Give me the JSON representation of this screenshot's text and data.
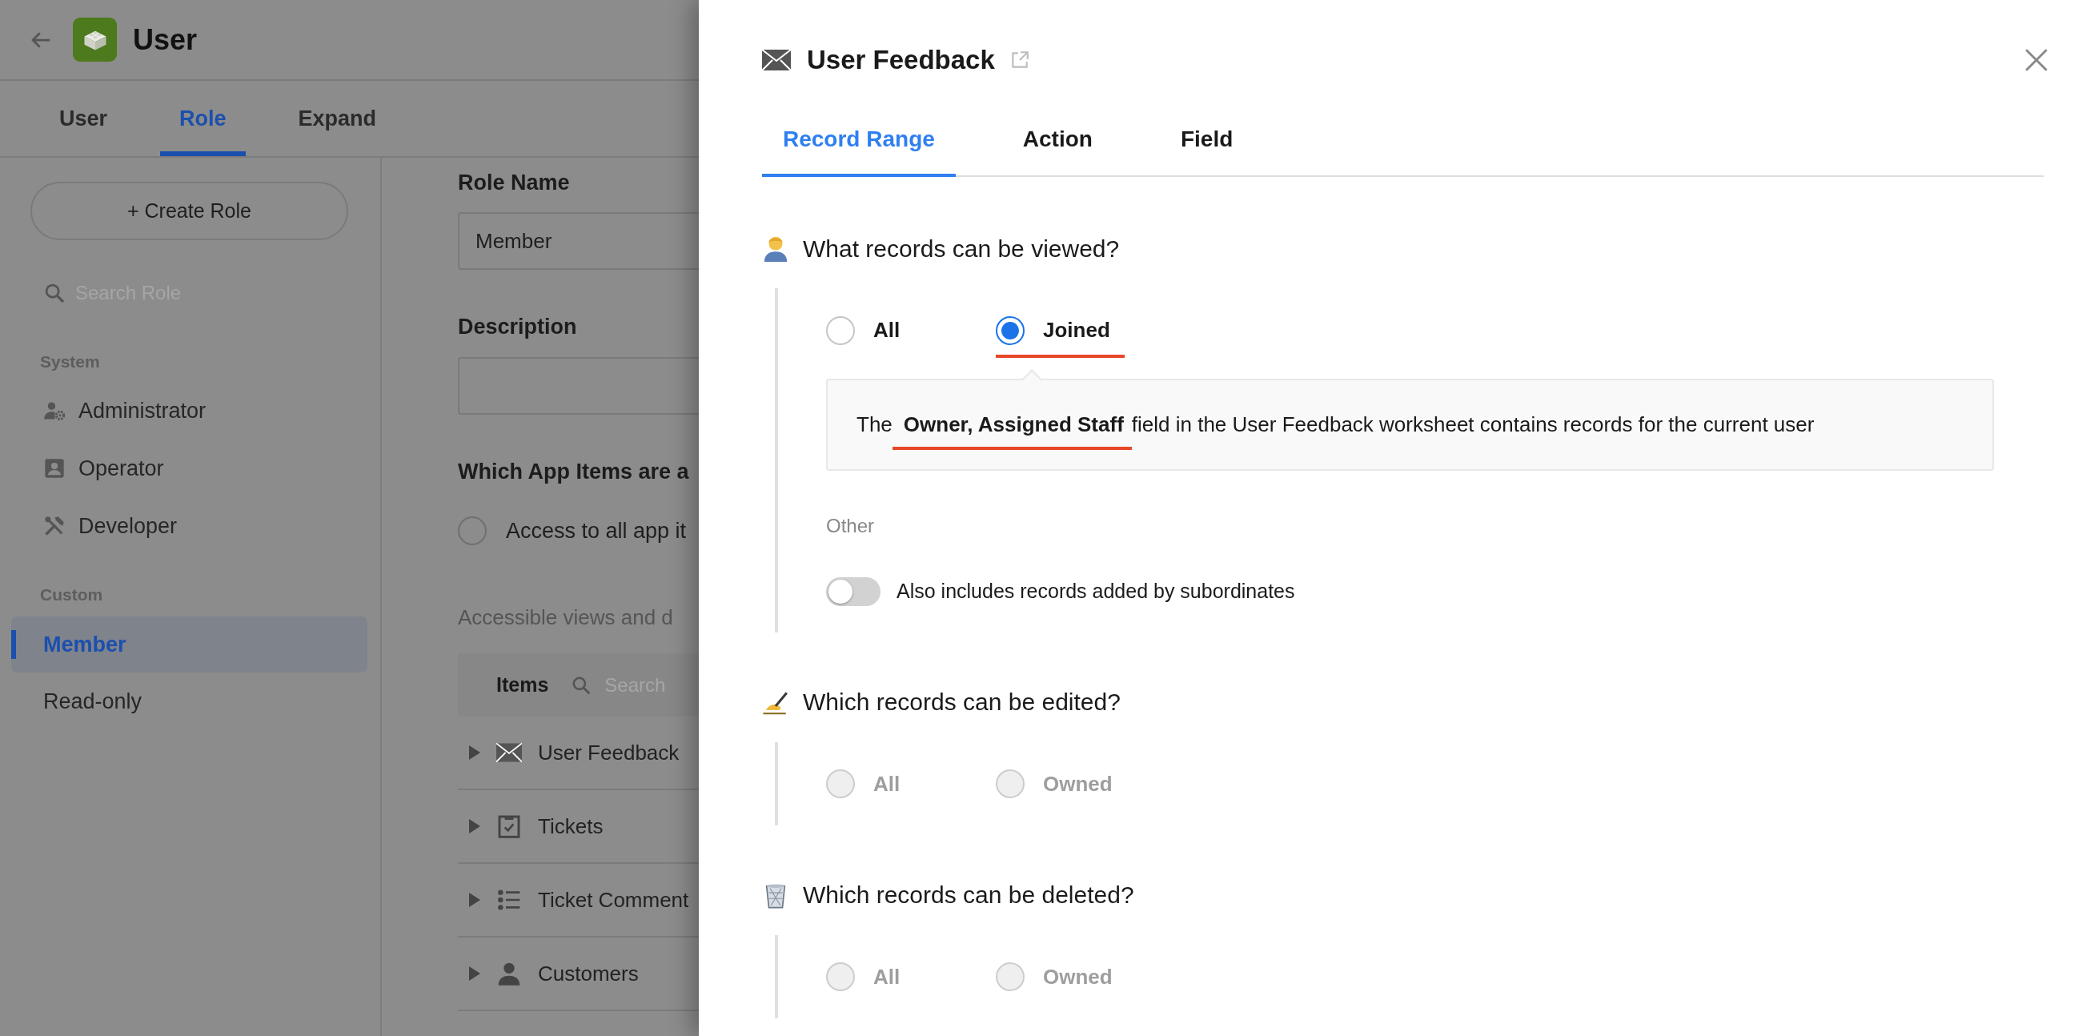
{
  "app_bar": {
    "title": "User"
  },
  "tabs": [
    {
      "label": "User",
      "selected": false
    },
    {
      "label": "Role",
      "selected": true
    },
    {
      "label": "Expand",
      "selected": false
    }
  ],
  "sidebar": {
    "create_button": "+ Create Role",
    "search_placeholder": "Search Role",
    "groups": [
      {
        "heading": "System",
        "items": [
          {
            "label": "Administrator",
            "selected": false
          },
          {
            "label": "Operator",
            "selected": false
          },
          {
            "label": "Developer",
            "selected": false
          }
        ]
      },
      {
        "heading": "Custom",
        "items": [
          {
            "label": "Member",
            "selected": true
          },
          {
            "label": "Read-only",
            "selected": false
          }
        ]
      }
    ]
  },
  "role_form": {
    "name_label": "Role Name",
    "name_value": "Member",
    "description_label": "Description",
    "items_heading": "Which App Items are a",
    "access_option": {
      "label": "Access to all app it",
      "selected": false
    },
    "accessible_note": "Accessible views and d",
    "items_table": {
      "header": "Items",
      "search_placeholder": "Search",
      "rows": [
        {
          "label": "User Feedback",
          "expanded": false
        },
        {
          "label": "Tickets",
          "expanded": false
        },
        {
          "label": "Ticket Comment",
          "expanded": false
        },
        {
          "label": "Customers",
          "expanded": false
        }
      ]
    }
  },
  "drawer": {
    "title": "User Feedback",
    "tabs": [
      {
        "label": "Record Range",
        "selected": true
      },
      {
        "label": "Action",
        "selected": false
      },
      {
        "label": "Field",
        "selected": false
      }
    ],
    "sections": [
      {
        "question": "What records can be viewed?",
        "options": [
          {
            "label": "All",
            "selected": false,
            "disabled": false,
            "annotated": false
          },
          {
            "label": "Joined",
            "selected": true,
            "disabled": false,
            "annotated": true
          }
        ],
        "info": {
          "prefix": "The",
          "field": "Owner, Assigned Staff",
          "suffix": "field in the User Feedback worksheet contains records for the current user",
          "field_annotated": true
        },
        "other_label": "Other",
        "toggle": {
          "label": "Also includes records added by subordinates",
          "on": false
        }
      },
      {
        "question": "Which records can be edited?",
        "options": [
          {
            "label": "All",
            "selected": false,
            "disabled": true
          },
          {
            "label": "Owned",
            "selected": false,
            "disabled": true
          }
        ]
      },
      {
        "question": "Which records can be deleted?",
        "options": [
          {
            "label": "All",
            "selected": false,
            "disabled": true
          },
          {
            "label": "Owned",
            "selected": false,
            "disabled": true
          }
        ]
      }
    ]
  }
}
